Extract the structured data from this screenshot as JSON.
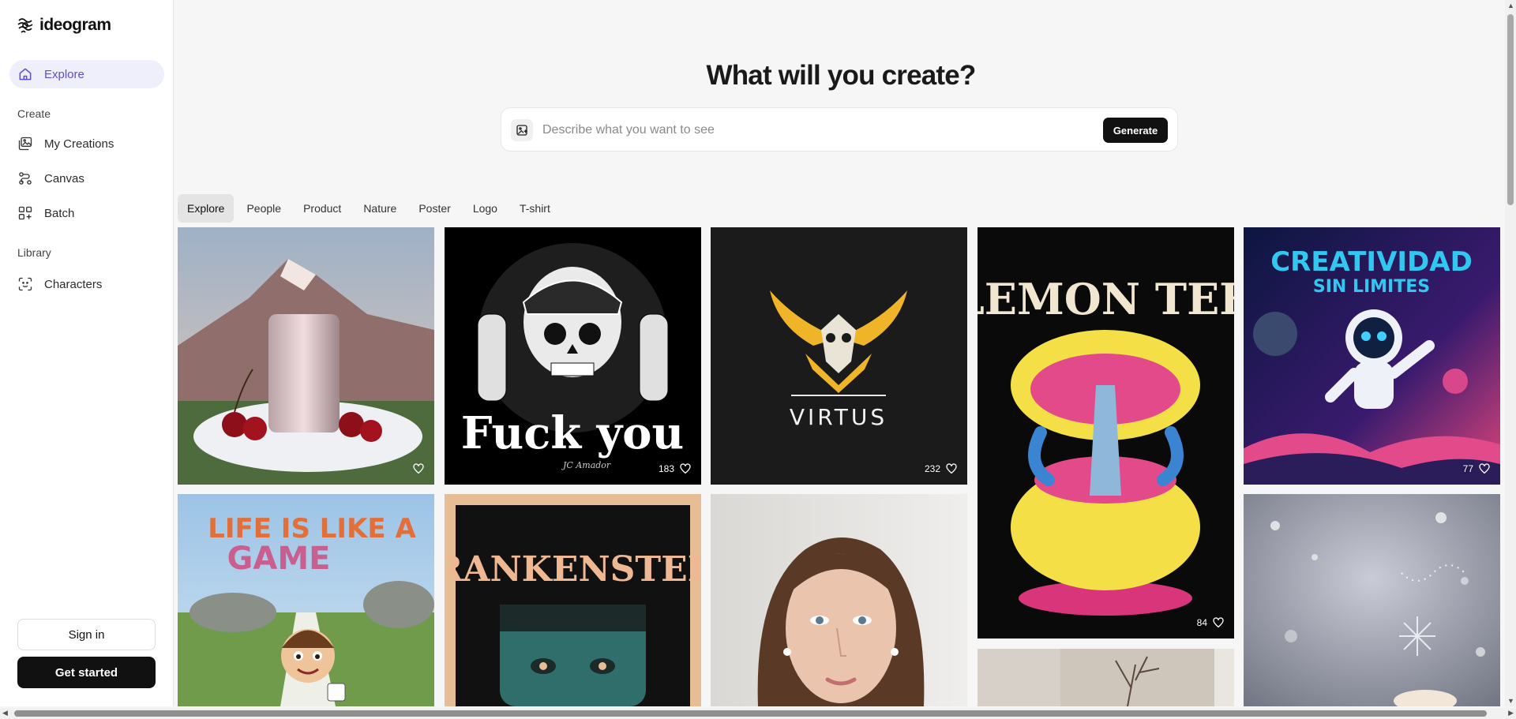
{
  "brand": {
    "name": "ideogram"
  },
  "sidebar": {
    "explore_label": "Explore",
    "create_section": "Create",
    "create_items": [
      {
        "label": "My Creations",
        "icon": "gallery-icon"
      },
      {
        "label": "Canvas",
        "icon": "canvas-icon"
      },
      {
        "label": "Batch",
        "icon": "batch-icon"
      }
    ],
    "library_section": "Library",
    "library_items": [
      {
        "label": "Characters",
        "icon": "face-scan-icon"
      }
    ],
    "signin_label": "Sign in",
    "get_started_label": "Get started"
  },
  "hero": {
    "title": "What will you create?",
    "placeholder": "Describe what you want to see",
    "generate_label": "Generate"
  },
  "tabs": [
    "Explore",
    "People",
    "Product",
    "Nature",
    "Poster",
    "Logo",
    "T-shirt"
  ],
  "gallery": [
    {
      "name": "card-cola-cherries",
      "likes": "",
      "text": ""
    },
    {
      "name": "card-skull-shirt",
      "likes": "183",
      "text": "Fuck you",
      "subtext": "JC Amador"
    },
    {
      "name": "card-virtus-logo",
      "likes": "232",
      "text": "VIRTUS"
    },
    {
      "name": "card-lemon-tek",
      "likes": "84",
      "text": "LEMON TEK"
    },
    {
      "name": "card-creatividad",
      "likes": "77",
      "text": "CREATIVIDAD",
      "subtext": "SIN LIMITES"
    },
    {
      "name": "card-life-game",
      "likes": "",
      "text": "LIFE IS LIKE A",
      "subtext": "GAME"
    },
    {
      "name": "card-frankenstein",
      "likes": "",
      "text": "FRANKENSTEIN"
    },
    {
      "name": "card-portrait",
      "likes": "",
      "text": ""
    },
    {
      "name": "card-interior",
      "likes": "",
      "text": ""
    },
    {
      "name": "card-snow-bokeh",
      "likes": "",
      "text": ""
    }
  ],
  "colors": {
    "accent": "#5a4fd6",
    "active_nav_bg": "#efeefb",
    "primary_button": "#111111"
  }
}
